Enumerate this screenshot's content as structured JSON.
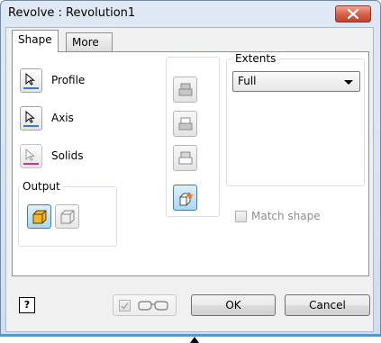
{
  "window": {
    "title": "Revolve : Revolution1",
    "close_icon": "close-x-icon"
  },
  "tabs": [
    {
      "label": "Shape",
      "active": true
    },
    {
      "label": "More",
      "active": false
    }
  ],
  "selectors": [
    {
      "label": "Profile",
      "icon": "cursor-arrow-icon",
      "underline_color": "#3a78c8",
      "enabled": true
    },
    {
      "label": "Axis",
      "icon": "cursor-arrow-icon",
      "underline_color": "#3a78c8",
      "enabled": true
    },
    {
      "label": "Solids",
      "icon": "cursor-arrow-icon",
      "underline_color": "#c8329a",
      "enabled": false
    }
  ],
  "output": {
    "label": "Output",
    "options": [
      {
        "name": "solid-output",
        "selected": true
      },
      {
        "name": "surface-output",
        "selected": false
      }
    ]
  },
  "operations": [
    {
      "name": "join",
      "enabled": false
    },
    {
      "name": "cut",
      "enabled": false
    },
    {
      "name": "intersect",
      "enabled": false
    },
    {
      "name": "new-solid",
      "enabled": true
    }
  ],
  "extents": {
    "label": "Extents",
    "selected": "Full"
  },
  "match_shape": {
    "label": "Match shape",
    "checked": false,
    "enabled": false
  },
  "footer": {
    "help_label": "?",
    "preview_icon": "glasses-icon",
    "ok_label": "OK",
    "cancel_label": "Cancel"
  },
  "colors": {
    "accent": "#3da3e0",
    "close": "#d9634a"
  }
}
